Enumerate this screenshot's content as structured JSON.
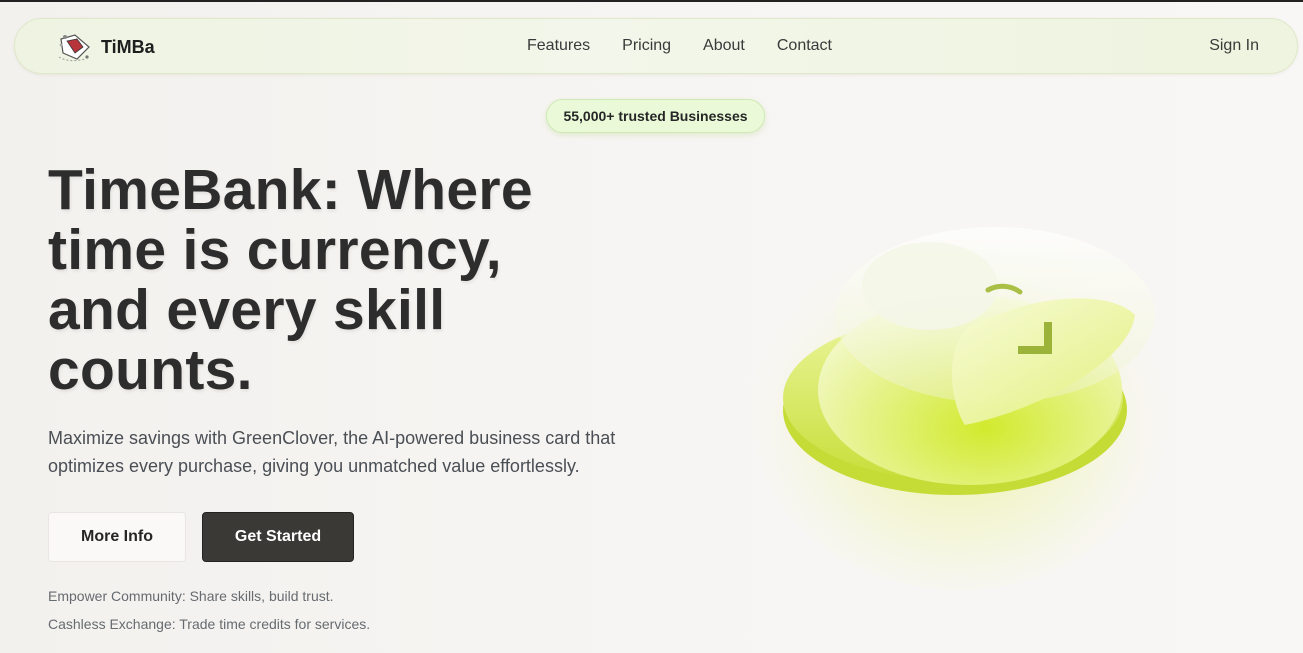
{
  "nav": {
    "brand": "TiMBa",
    "links": [
      "Features",
      "Pricing",
      "About",
      "Contact"
    ],
    "sign_in": "Sign In"
  },
  "hero": {
    "badge": "55,000+ trusted Businesses",
    "headline_lines": [
      "TimeBank: Where",
      "time is currency,",
      "and every skill",
      "counts."
    ],
    "subtitle_lines": [
      "Maximize savings with GreenClover, the AI-powered business card that",
      "optimizes every purchase, giving you unmatched value effortlessly."
    ],
    "buttons": {
      "more_info": "More Info",
      "get_started": "Get Started"
    },
    "features": [
      "Empower Community: Share skills, build trust.",
      "Cashless Exchange: Trade time credits for services."
    ]
  },
  "colors": {
    "accent_lime": "#d9f05a",
    "badge_bg": "#eafad8",
    "primary_button": "#3a3935",
    "navbar_bg": "#eef3e2"
  },
  "icons": [
    "logo-icon",
    "coin-stack-illustration"
  ]
}
